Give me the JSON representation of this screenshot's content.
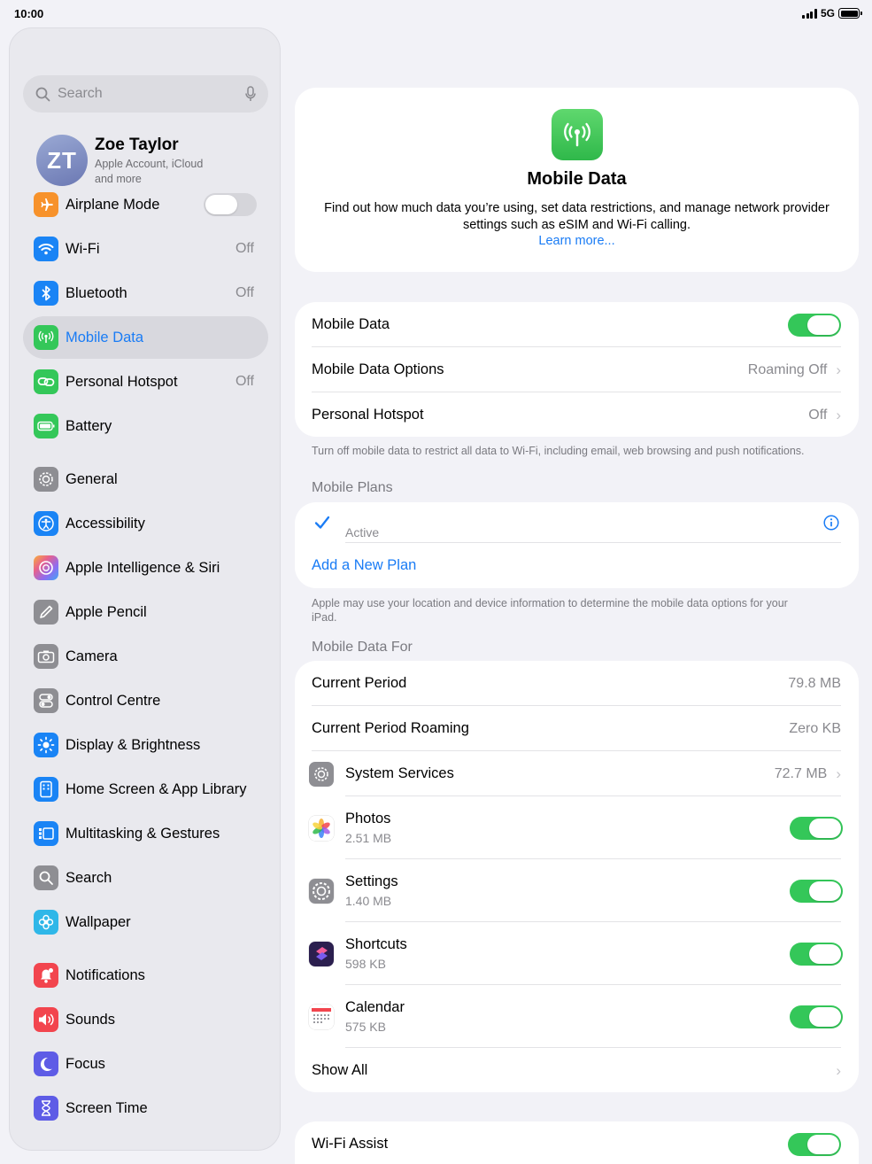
{
  "status": {
    "time": "10:00",
    "network": "5G"
  },
  "sidebar": {
    "search_placeholder": "Search",
    "profile": {
      "initials": "ZT",
      "name": "Zoe Taylor",
      "subtitle": "Apple Account, iCloud and more"
    },
    "items": [
      {
        "label": "Airplane Mode",
        "value": "",
        "icon": "airplane-icon",
        "color": "#f7922b"
      },
      {
        "label": "Wi-Fi",
        "value": "Off",
        "icon": "wifi-icon",
        "color": "#1a84f5"
      },
      {
        "label": "Bluetooth",
        "value": "Off",
        "icon": "bluetooth-icon",
        "color": "#1a84f5"
      },
      {
        "label": "Mobile Data",
        "value": "",
        "icon": "antenna-icon",
        "color": "#34c759"
      },
      {
        "label": "Personal Hotspot",
        "value": "Off",
        "icon": "hotspot-icon",
        "color": "#34c759"
      },
      {
        "label": "Battery",
        "value": "",
        "icon": "battery-icon",
        "color": "#34c759"
      },
      {
        "label": "General",
        "value": "",
        "icon": "gear-icon",
        "color": "#8e8e93"
      },
      {
        "label": "Accessibility",
        "value": "",
        "icon": "accessibility-icon",
        "color": "#1a84f5"
      },
      {
        "label": "Apple Intelligence & Siri",
        "value": "",
        "icon": "siri-icon",
        "color": "#e8618c"
      },
      {
        "label": "Apple Pencil",
        "value": "",
        "icon": "pencil-icon",
        "color": "#8e8e93"
      },
      {
        "label": "Camera",
        "value": "",
        "icon": "camera-icon",
        "color": "#8e8e93"
      },
      {
        "label": "Control Centre",
        "value": "",
        "icon": "switches-icon",
        "color": "#8e8e93"
      },
      {
        "label": "Display & Brightness",
        "value": "",
        "icon": "sun-icon",
        "color": "#1a84f5"
      },
      {
        "label": "Home Screen & App Library",
        "value": "",
        "icon": "home-screen-icon",
        "color": "#1a84f5"
      },
      {
        "label": "Multitasking & Gestures",
        "value": "",
        "icon": "multitasking-icon",
        "color": "#1a84f5"
      },
      {
        "label": "Search",
        "value": "",
        "icon": "search-icon",
        "color": "#8e8e93"
      },
      {
        "label": "Wallpaper",
        "value": "",
        "icon": "flower-icon",
        "color": "#2fb7e8"
      },
      {
        "label": "Notifications",
        "value": "",
        "icon": "bell-icon",
        "color": "#f2454e"
      },
      {
        "label": "Sounds",
        "value": "",
        "icon": "speaker-icon",
        "color": "#f2454e"
      },
      {
        "label": "Focus",
        "value": "",
        "icon": "moon-icon",
        "color": "#5e5ce6"
      },
      {
        "label": "Screen Time",
        "value": "",
        "icon": "hourglass-icon",
        "color": "#5e5ce6"
      }
    ]
  },
  "hero": {
    "title": "Mobile Data",
    "description": "Find out how much data you’re using, set data restrictions, and manage network provider settings such as eSIM and Wi-Fi calling.",
    "link": "Learn more..."
  },
  "main_settings": {
    "mobile_data": "Mobile Data",
    "options_label": "Mobile Data Options",
    "options_value": "Roaming Off",
    "hotspot_label": "Personal Hotspot",
    "hotspot_value": "Off",
    "footer": "Turn off mobile data to restrict all data to Wi-Fi, including email, web browsing and push notifications."
  },
  "plans": {
    "header": "Mobile Plans",
    "status": "Active",
    "add": "Add a New Plan",
    "footer": "Apple may use your location and device information to determine the mobile data options for your iPad."
  },
  "usage": {
    "header": "Mobile Data For",
    "current_label": "Current Period",
    "current_value": "79.8 MB",
    "roaming_label": "Current Period Roaming",
    "roaming_value": "Zero KB",
    "system_label": "System Services",
    "system_value": "72.7 MB",
    "apps": [
      {
        "name": "Photos",
        "size": "2.51 MB",
        "icon": "photos-icon"
      },
      {
        "name": "Settings",
        "size": "1.40 MB",
        "icon": "settings-icon"
      },
      {
        "name": "Shortcuts",
        "size": "598 KB",
        "icon": "shortcuts-icon"
      },
      {
        "name": "Calendar",
        "size": "575 KB",
        "icon": "calendar-icon"
      }
    ],
    "show_all": "Show All"
  },
  "wifi_assist": {
    "label": "Wi-Fi Assist"
  },
  "colors": {
    "accent": "#1a7cf5",
    "toggle_on": "#34c759"
  }
}
